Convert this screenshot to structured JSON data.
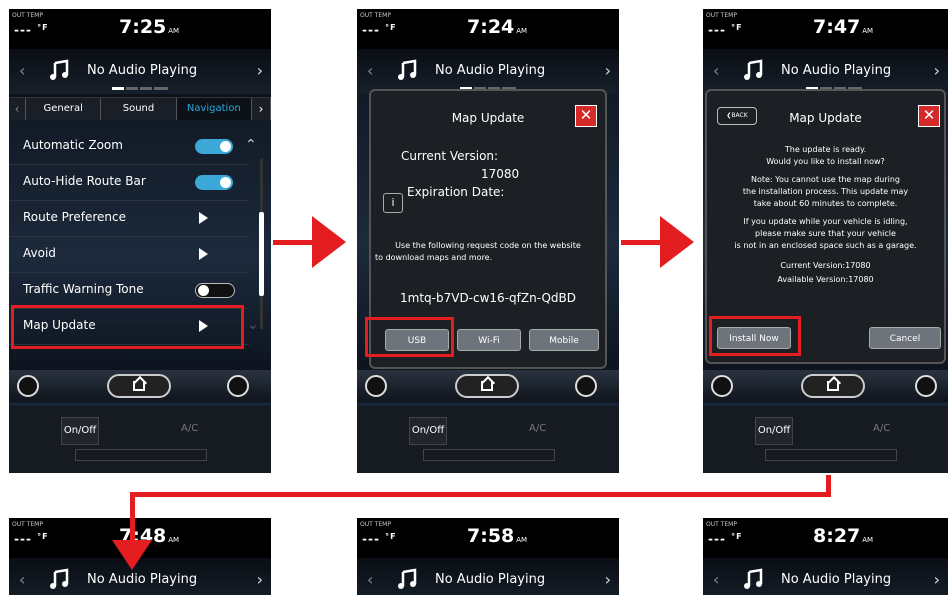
{
  "common": {
    "out_temp_label": "OUT TEMP",
    "out_temp_value": "---",
    "out_temp_unit": "°F",
    "am": "AM",
    "audio": "No Audio Playing",
    "onoff": "On/Off",
    "ac": "A/C"
  },
  "screens": [
    {
      "clock": "7:25"
    },
    {
      "clock": "7:24"
    },
    {
      "clock": "7:47"
    },
    {
      "clock": "7:48"
    },
    {
      "clock": "7:58"
    },
    {
      "clock": "8:27"
    }
  ],
  "settings": {
    "tabs": [
      "General",
      "Sound",
      "Navigation"
    ],
    "active_tab": "Navigation",
    "rows": [
      {
        "label": "Automatic Zoom",
        "control": "toggle-on"
      },
      {
        "label": "Auto-Hide Route Bar",
        "control": "toggle-on"
      },
      {
        "label": "Route Preference",
        "control": "arrow"
      },
      {
        "label": "Avoid",
        "control": "arrow"
      },
      {
        "label": "Traffic Warning Tone",
        "control": "toggle-off"
      },
      {
        "label": "Map Update",
        "control": "arrow"
      }
    ]
  },
  "map_update_dialog": {
    "title": "Map Update",
    "current_version_label": "Current Version:",
    "current_version": "17080",
    "expiration_label": "Expiration Date:",
    "info_text_1": "Use the following request code on the website",
    "info_text_2": "to download maps and more.",
    "request_code": "1mtq-b7VD-cw16-qfZn-QdBD",
    "buttons": [
      "USB",
      "Wi-Fi",
      "Mobile"
    ]
  },
  "install_dialog": {
    "back": "BACK",
    "title": "Map Update",
    "lines": [
      "The update is ready.",
      "Would you like to install now?",
      "Note: You cannot use the map during",
      "the installation process. This update may",
      "take about 60 minutes to complete.",
      "If you update while your vehicle is idling,",
      "please make sure that your vehicle",
      "is not in an enclosed space such as a garage.",
      "Current Version:17080",
      "Available Version:17080"
    ],
    "install_button": "Install Now",
    "cancel_button": "Cancel"
  },
  "colors": {
    "highlight": "#e41e20",
    "toggle_on": "#3ba8d8",
    "active_tab": "#2ea8e0",
    "close": "#d42a2a"
  }
}
